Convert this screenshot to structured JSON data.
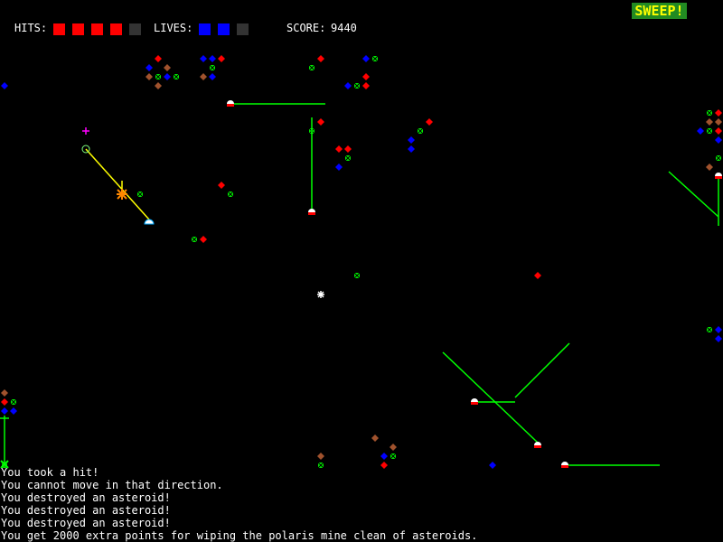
{
  "hud": {
    "hits_label": "HITS:",
    "hits": {
      "filled": 4,
      "total": 5
    },
    "lives_label": "LIVES:",
    "lives": {
      "filled": 2,
      "total": 3
    },
    "score_label": "SCORE:",
    "score_value": "9440",
    "sweep_badge": "SWEEP!"
  },
  "colors": {
    "background": "#000000",
    "hits_filled": "#ff0000",
    "lives_filled": "#0000ff",
    "empty_slot": "#333333",
    "laser": "#00ff00",
    "tether": "#ffff00",
    "sweep_bg": "#228b22",
    "sweep_text": "#ffff00"
  },
  "messages": [
    "You took a hit!",
    "You cannot move in that direction.",
    "You destroyed an asteroid!",
    "You destroyed an asteroid!",
    "You destroyed an asteroid!",
    "You get 2000 extra points for wiping the polaris mine clean of asteroids."
  ]
}
